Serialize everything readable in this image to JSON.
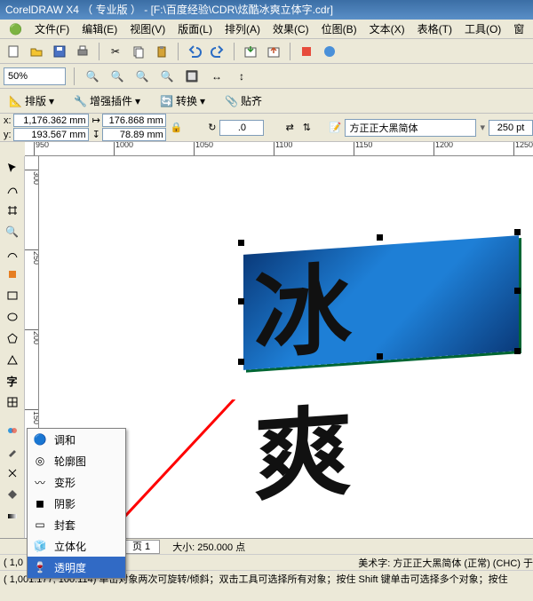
{
  "title": "CorelDRAW X4 （ 专业版 ） - [F:\\百度经验\\CDR\\炫酷冰爽立体字.cdr]",
  "menu": [
    "文件(F)",
    "编辑(E)",
    "视图(V)",
    "版面(L)",
    "排列(A)",
    "效果(C)",
    "位图(B)",
    "文本(X)",
    "表格(T)",
    "工具(O)",
    "窗"
  ],
  "zoom": "50%",
  "propbar": {
    "arrange": "排版",
    "plugin": "增强插件",
    "convert": "转换",
    "align": "贴齐"
  },
  "coords": {
    "x": "1,176.362 mm",
    "y": "193.567 mm",
    "w": "176.868 mm",
    "h": "78.89 mm",
    "rotation": ".0",
    "font": "方正正大黑简体",
    "fontsize": "250 pt"
  },
  "ruler_h": [
    "950",
    "1000",
    "1050",
    "1100",
    "1150",
    "1200",
    "1250"
  ],
  "ruler_v": [
    "300",
    "250",
    "200",
    "150"
  ],
  "artwork_text": "冰 爽",
  "flyout": {
    "items": [
      {
        "icon": "blend",
        "label": "调和"
      },
      {
        "icon": "contour",
        "label": "轮廓图"
      },
      {
        "icon": "distort",
        "label": "变形"
      },
      {
        "icon": "shadow",
        "label": "阴影"
      },
      {
        "icon": "envelope",
        "label": "封套"
      },
      {
        "icon": "extrude",
        "label": "立体化"
      },
      {
        "icon": "transparency",
        "label": "透明度"
      }
    ],
    "selected_index": 6
  },
  "pagetabs": {
    "size": "大小: 250.000 点",
    "page_label": "页 1"
  },
  "status": {
    "left": "( 1,0",
    "right": "美术字: 方正正大黑简体 (正常) (CHC) 于",
    "line2": "( 1,001.177, 100.114)  单击对象两次可旋转/倾斜；双击工具可选择所有对象；按住 Shift 键单击可选择多个对象；按住"
  }
}
